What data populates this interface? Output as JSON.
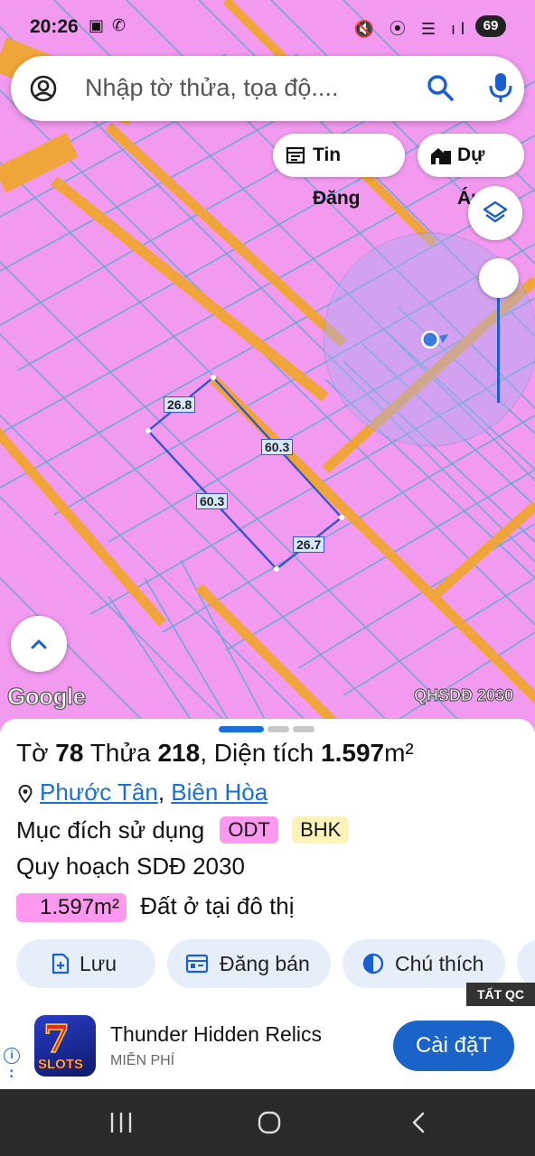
{
  "status_bar": {
    "time": "20:26",
    "left_icons": "▣ ✆",
    "right_icons": "🔇 ⦿ ☰ ıl",
    "battery": "69"
  },
  "search": {
    "placeholder": "Nhập tờ thửa, tọa độ...."
  },
  "map_chips": {
    "tin_dang": "Tin Đăng",
    "du_an": "Dự Án"
  },
  "map": {
    "parcel_lengths": [
      "26.8",
      "60.3",
      "60.3",
      "26.7"
    ],
    "attribution": "Google",
    "layer_name": "QHSDĐ 2030",
    "colors": {
      "land": "#f29af0",
      "road": "#f0a53a",
      "lines": "#6ea9d8",
      "parcel_outline": "#3a55c8"
    }
  },
  "info": {
    "to_label": "Tờ",
    "to_value": "78",
    "thua_label": "Thửa",
    "thua_value": "218",
    "dientich_label": "Diện tích",
    "dientich_value": "1.597",
    "dientich_unit": "m²",
    "ward": "Phước Tân",
    "city": "Biên Hòa",
    "purpose_label": "Mục đích sử dụng",
    "purpose_codes": [
      "ODT",
      "BHK"
    ],
    "plan_label": "Quy hoạch SDĐ 2030",
    "area_value": "1.597m²",
    "area_desc": "Đất ở tại đô thị"
  },
  "actions": {
    "save": "Lưu",
    "sell": "Đăng bán",
    "legend": "Chú thích"
  },
  "ad": {
    "tag": "TẤT QC",
    "title": "Thunder Hidden Relics",
    "subtitle": "MIỄN PHÍ",
    "button": "Cài đặT",
    "logo_text": "SLOTS"
  }
}
